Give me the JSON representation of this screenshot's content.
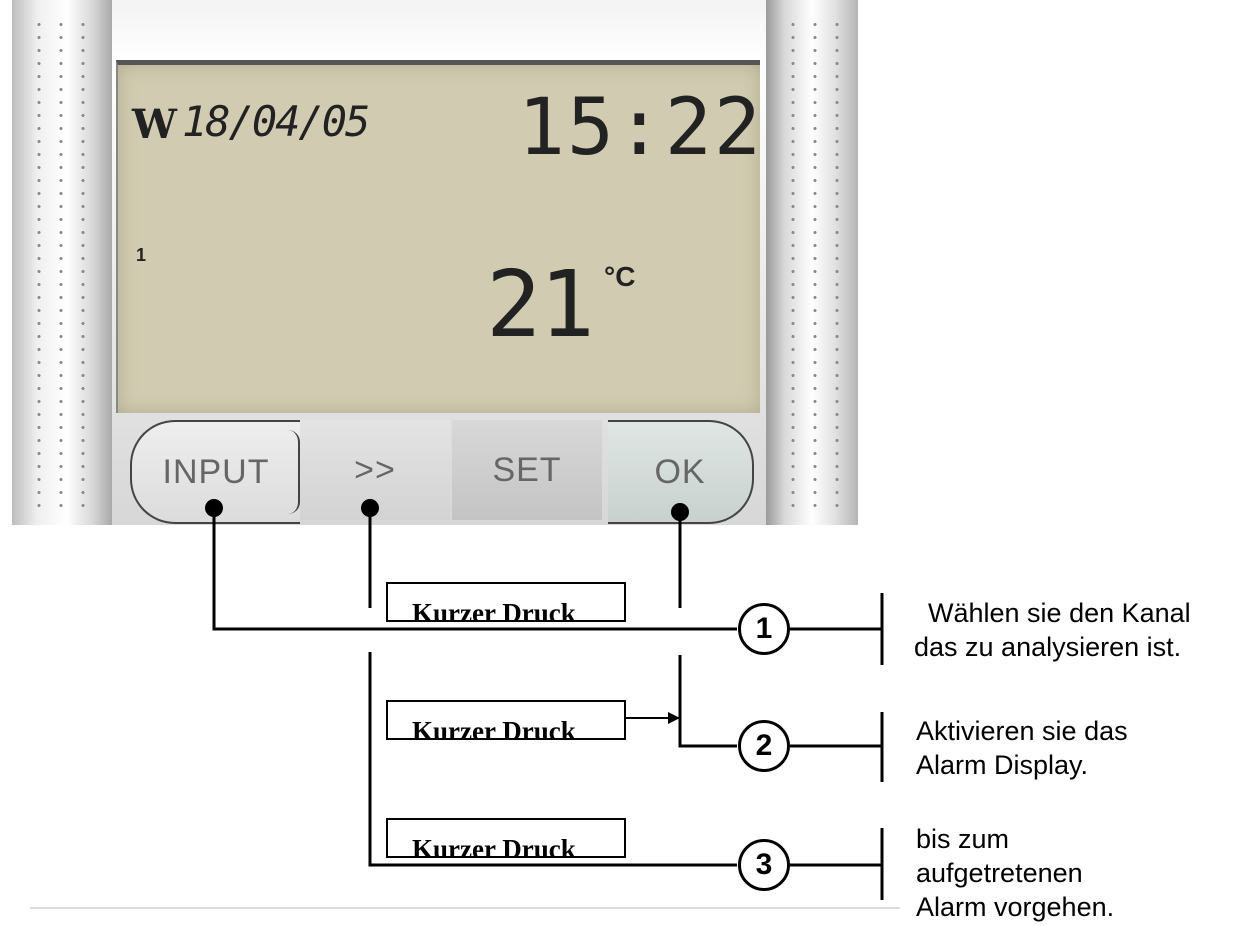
{
  "device": {
    "logo": "W",
    "date": "18/04/05",
    "time": "15:22",
    "channel": "1",
    "temperature": "21",
    "unit": "°C",
    "buttons": {
      "input": "INPUT",
      "next": ">>",
      "set": "SET",
      "ok": "OK"
    }
  },
  "callouts": {
    "box_label": "Kurzer Druck",
    "steps": [
      {
        "number": "1",
        "text_line1": "Wählen sie den Kanal",
        "text_line2": "das zu analysieren ist."
      },
      {
        "number": "2",
        "text_line1": "Aktivieren sie das",
        "text_line2": "Alarm Display."
      },
      {
        "number": "3",
        "text_line1": "bis zum",
        "text_line2": "aufgetretenen",
        "text_line3": "Alarm vorgehen."
      }
    ]
  }
}
